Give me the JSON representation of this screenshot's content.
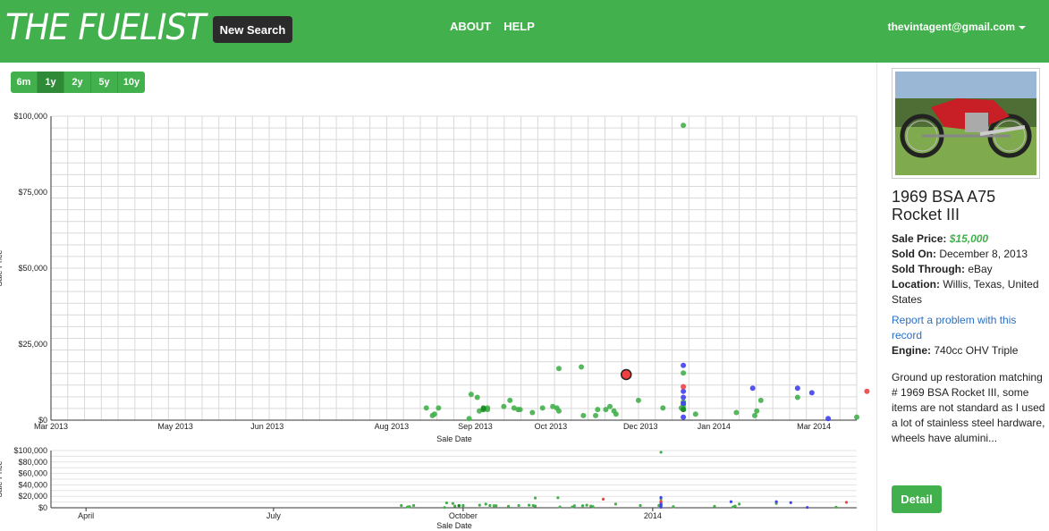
{
  "header": {
    "logo": "THE FUELIST",
    "new_search": "New Search",
    "nav": [
      "ABOUT",
      "HELP"
    ],
    "user_email": "thevintagent@gmail.com"
  },
  "range_buttons": [
    "6m",
    "1y",
    "2y",
    "5y",
    "10y"
  ],
  "range_selected": "1y",
  "colors": {
    "brand": "#42b04c",
    "dark_button": "#2b2b2b",
    "link": "#2a6fc4",
    "point_green": "#43b04a",
    "point_dark_green": "#1a8a22",
    "point_blue": "#4040f0",
    "point_red": "#f04040"
  },
  "chart_data": [
    {
      "type": "scatter",
      "xlabel": "Sale Date",
      "ylabel": "Sale Price",
      "x_ticks": [
        "Mar 2013",
        "May 2013",
        "Jun 2013",
        "Aug 2013",
        "Sep 2013",
        "Oct 2013",
        "Dec 2013",
        "Jan 2014",
        "Mar 2014"
      ],
      "y_ticks": [
        "$0",
        "$25,000",
        "$50,000",
        "$75,000",
        "$100,000"
      ],
      "ylim": [
        0,
        100000
      ],
      "xlim": [
        "2013-03-01",
        "2014-03-31"
      ],
      "grid": true,
      "series": [
        {
          "color": "green",
          "points": [
            [
              "2013-09-01",
              4000
            ],
            [
              "2013-09-04",
              1500
            ],
            [
              "2013-09-05",
              2000
            ],
            [
              "2013-09-07",
              4000
            ],
            [
              "2013-09-22",
              500
            ],
            [
              "2013-09-23",
              8500
            ],
            [
              "2013-09-26",
              7500
            ],
            [
              "2013-09-27",
              3000
            ],
            [
              "2013-10-01",
              4000
            ],
            [
              "2013-10-01",
              3500
            ],
            [
              "2013-10-09",
              4500
            ],
            [
              "2013-10-12",
              6500
            ],
            [
              "2013-10-14",
              4000
            ],
            [
              "2013-10-16",
              3500
            ],
            [
              "2013-10-17",
              3500
            ],
            [
              "2013-10-23",
              2500
            ],
            [
              "2013-10-28",
              4000
            ],
            [
              "2013-11-02",
              4500
            ],
            [
              "2013-11-04",
              4000
            ],
            [
              "2013-11-05",
              17000
            ],
            [
              "2013-11-05",
              3000
            ],
            [
              "2013-11-16",
              17500
            ],
            [
              "2013-11-17",
              1500
            ],
            [
              "2013-11-23",
              1500
            ],
            [
              "2013-11-24",
              3500
            ],
            [
              "2013-11-28",
              3500
            ],
            [
              "2013-11-30",
              4500
            ],
            [
              "2013-12-02",
              3000
            ],
            [
              "2013-12-03",
              2000
            ],
            [
              "2013-12-14",
              6500
            ],
            [
              "2013-12-26",
              4000
            ],
            [
              "2014-01-04",
              4000
            ],
            [
              "2014-01-05",
              97000
            ],
            [
              "2014-01-05",
              15500
            ],
            [
              "2014-01-05",
              6000
            ],
            [
              "2014-01-05",
              5000
            ],
            [
              "2014-01-05",
              4000
            ],
            [
              "2014-01-05",
              3500
            ],
            [
              "2014-01-11",
              2000
            ],
            [
              "2014-01-31",
              2500
            ],
            [
              "2014-02-09",
              1500
            ],
            [
              "2014-02-10",
              3000
            ],
            [
              "2014-02-12",
              6500
            ],
            [
              "2014-03-02",
              7500
            ],
            [
              "2014-03-31",
              1000
            ]
          ]
        },
        {
          "color": "dark_green",
          "points": [
            [
              "2013-09-29",
              4000
            ],
            [
              "2013-09-29",
              3500
            ],
            [
              "2014-01-05",
              3500
            ]
          ]
        },
        {
          "color": "blue",
          "points": [
            [
              "2014-01-05",
              18000
            ],
            [
              "2014-01-05",
              9500
            ],
            [
              "2014-01-05",
              7500
            ],
            [
              "2014-01-05",
              5500
            ],
            [
              "2014-01-05",
              1000
            ],
            [
              "2014-02-08",
              10500
            ],
            [
              "2014-03-02",
              10500
            ],
            [
              "2014-03-09",
              9000
            ],
            [
              "2014-03-17",
              500
            ]
          ]
        },
        {
          "color": "red",
          "points": [
            [
              "2014-01-05",
              11000
            ],
            [
              "2014-04-05",
              9500
            ]
          ]
        },
        {
          "color": "selected_red",
          "points": [
            [
              "2013-12-08",
              15000
            ]
          ]
        }
      ]
    },
    {
      "type": "scatter",
      "xlabel": "Sale Date",
      "ylabel": "Sale Price",
      "x_ticks": [
        "April",
        "July",
        "October",
        "2014"
      ],
      "y_ticks": [
        "$0",
        "$20,000",
        "$40,000",
        "$60,000",
        "$80,000",
        "$100,000"
      ],
      "ylim": [
        0,
        100000
      ],
      "xlim": [
        "2013-03-15",
        "2014-04-10"
      ],
      "grid": true
    }
  ],
  "detail": {
    "title": "1969 BSA A75 Rocket III",
    "sale_price_label": "Sale Price:",
    "sale_price": "$15,000",
    "sold_on_label": "Sold On:",
    "sold_on": "December 8, 2013",
    "sold_through_label": "Sold Through:",
    "sold_through": "eBay",
    "location_label": "Location:",
    "location": "Willis, Texas, United States",
    "report_link": "Report a problem with this record",
    "engine_label": "Engine:",
    "engine": "740cc OHV Triple",
    "description": "Ground up restoration matching # 1969 BSA Rocket III, some items are not standard as I used a lot of stainless steel hardware, wheels have alumini...",
    "detail_button": "Detail"
  }
}
